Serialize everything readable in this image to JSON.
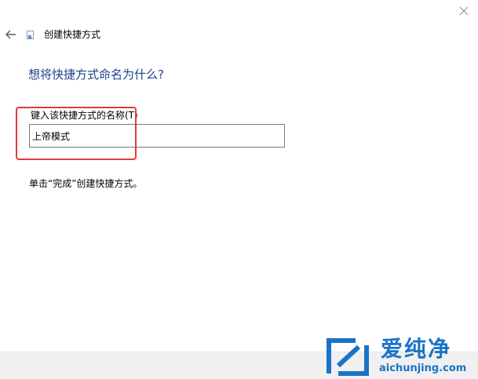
{
  "window": {
    "title": "创建快捷方式"
  },
  "page": {
    "heading": "想将快捷方式命名为什么?",
    "field_label": "键入该快捷方式的名称(T)",
    "name_value": "上帝模式",
    "instruction": "单击“完成”创建快捷方式。"
  },
  "icons": {
    "back": "back-arrow-icon",
    "close": "close-icon",
    "wizard": "shortcut-wizard-icon",
    "watermark_logo": "aichunjing-logo-icon"
  },
  "watermark": {
    "brand_text": "爱纯净",
    "url_text": "aichunjing.com"
  },
  "colors": {
    "heading": "#1e3e8c",
    "highlight": "#e33a3a",
    "footer_bg": "#f0f0f0",
    "watermark": "#1a73c8"
  }
}
